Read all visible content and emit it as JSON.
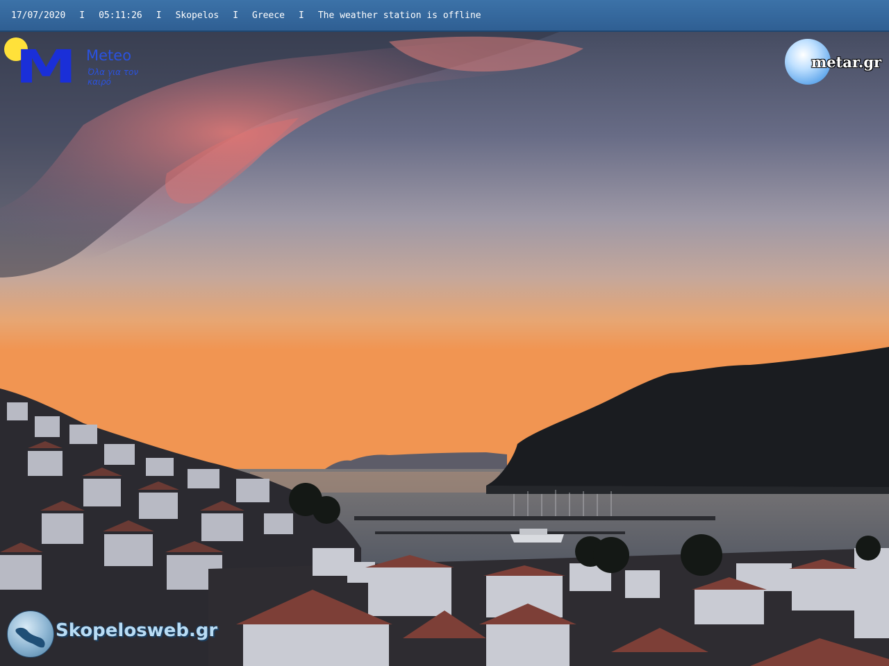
{
  "status_bar": {
    "date": "17/07/2020",
    "time": "05:11:26",
    "location": "Skopelos",
    "country": "Greece",
    "station_status": "The weather station is offline",
    "separator": "I"
  },
  "logos": {
    "meteo": {
      "title": "Meteo",
      "tagline": "Όλα για τον καιρό",
      "mark": "M"
    },
    "metar": {
      "text": "metar.gr"
    },
    "skopelosweb": {
      "text": "Skopelosweb.gr"
    }
  },
  "scene": {
    "description_icon": "webcam-photo",
    "colors": {
      "sky_top": "#3d4458",
      "sky_horizon": "#f29a55",
      "cloud": "#d96b6b",
      "water": "#595e6b",
      "hill": "#17191c"
    }
  }
}
